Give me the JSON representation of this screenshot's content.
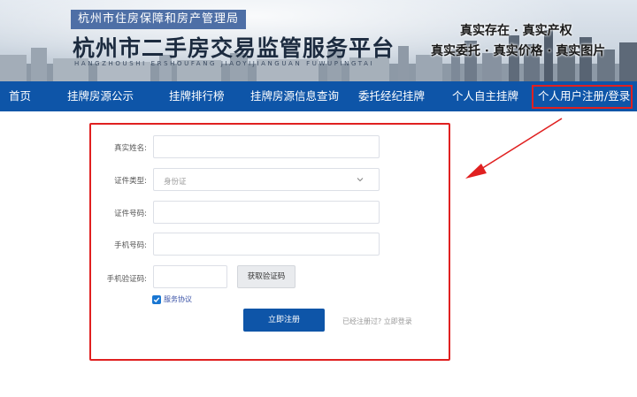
{
  "header": {
    "org_name": "杭州市住房保障和房产管理局",
    "site_title": "杭州市二手房交易监管服务平台",
    "site_pinyin": "HANGZHOUSHI ERSHOUFANG JIAOYIJIANGUAN FUWUPINGTAI",
    "slogan_1": "真实存在 · 真实产权",
    "slogan_2": "真实委托 · 真实价格 · 真实图片"
  },
  "nav": {
    "items": [
      {
        "label": "首页"
      },
      {
        "label": "挂牌房源公示"
      },
      {
        "label": "挂牌排行榜"
      },
      {
        "label": "挂牌房源信息查询"
      },
      {
        "label": "委托经纪挂牌"
      },
      {
        "label": "个人自主挂牌"
      },
      {
        "label": "个人用户注册/登录"
      }
    ],
    "active_index": 6
  },
  "form": {
    "name_label": "真实姓名:",
    "id_type_label": "证件类型:",
    "id_type_value": "身份证",
    "id_number_label": "证件号码:",
    "phone_label": "手机号码:",
    "code_label": "手机验证码:",
    "get_code_button": "获取验证码",
    "agreement_checked": true,
    "agreement_label": "服务协议",
    "submit_button": "立即注册",
    "login_prompt": "已经注册过?",
    "login_link": "立即登录"
  },
  "colors": {
    "nav_bg": "#0e55a8",
    "highlight": "#e02020",
    "primary": "#0e55a8"
  }
}
